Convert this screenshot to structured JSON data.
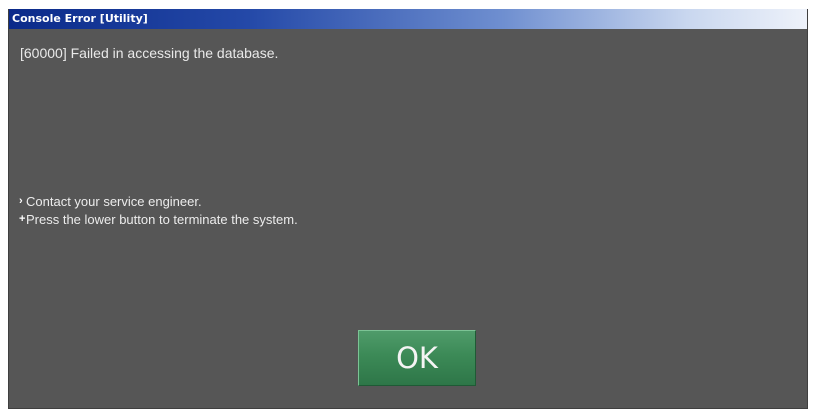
{
  "window": {
    "title": "Console Error [Utility]"
  },
  "message": {
    "text": "[60000] Failed in accessing the database."
  },
  "hints": [
    {
      "icon": "arrow-bullet",
      "text": "Contact your service engineer."
    },
    {
      "icon": "plus-bullet",
      "text": "Press the lower button to terminate the system."
    }
  ],
  "button": {
    "ok_label": "OK"
  },
  "colors": {
    "body_background": "#565656",
    "titlebar_start": "#0b2a8a",
    "titlebar_end": "#eef2fa",
    "ok_button": "#3c8a57"
  }
}
